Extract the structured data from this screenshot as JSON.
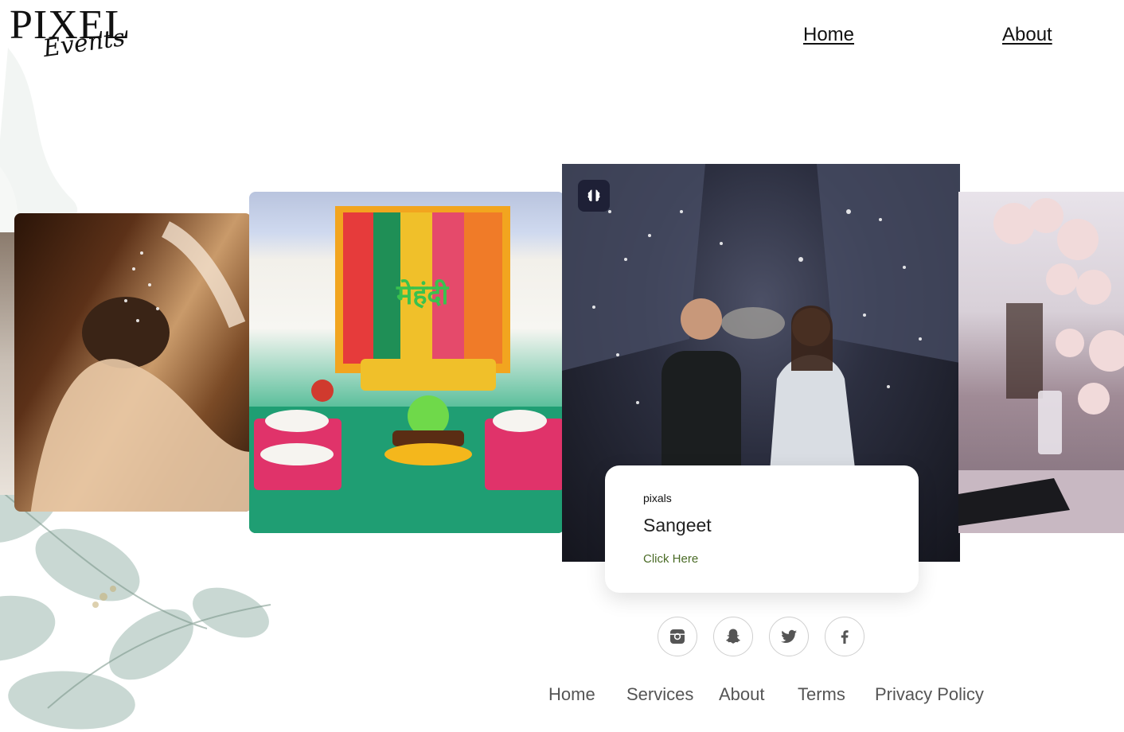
{
  "brand": {
    "name": "PIXEL",
    "tagline": "Events"
  },
  "topnav": {
    "home": "Home",
    "about": "About"
  },
  "carousel": {
    "active_card": {
      "eyebrow": "pixals",
      "title": "Sangeet",
      "cta": "Click Here",
      "badge_icon": "brain-icon"
    },
    "mid_card_sign": "मेहंदी"
  },
  "social": [
    {
      "name": "instagram-icon"
    },
    {
      "name": "snapchat-icon"
    },
    {
      "name": "twitter-icon"
    },
    {
      "name": "facebook-icon"
    }
  ],
  "footer": {
    "links": [
      "Home",
      "Services",
      "About",
      "Terms",
      "Privacy Policy"
    ]
  },
  "colors": {
    "link_green": "#4a6b26",
    "badge_bg": "#1e2036",
    "footer_text": "#555555"
  }
}
